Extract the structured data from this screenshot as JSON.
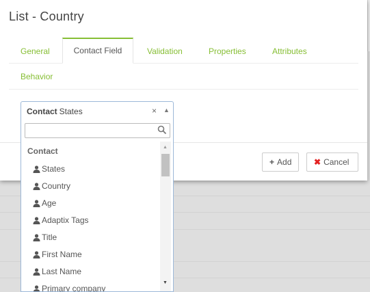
{
  "modal": {
    "title": "List - Country"
  },
  "tabs": [
    {
      "label": "General"
    },
    {
      "label": "Contact Field"
    },
    {
      "label": "Validation"
    },
    {
      "label": "Properties"
    },
    {
      "label": "Attributes"
    },
    {
      "label": "Behavior"
    }
  ],
  "active_tab": "Contact Field",
  "select": {
    "group": "Contact",
    "value": "States",
    "clear": "×",
    "arrow": "▲"
  },
  "dropdown": {
    "search_value": "",
    "group_label": "Contact",
    "options": [
      {
        "label": "States"
      },
      {
        "label": "Country"
      },
      {
        "label": "Age"
      },
      {
        "label": "Adaptix Tags"
      },
      {
        "label": "Title"
      },
      {
        "label": "First Name"
      },
      {
        "label": "Last Name"
      },
      {
        "label": "Primary company"
      }
    ],
    "option_icon": "user-icon"
  },
  "buttons": {
    "add_icon": "+",
    "add_label": "Add",
    "cancel_icon": "✖",
    "cancel_label": "Cancel"
  },
  "colors": {
    "accent_green": "#86be34",
    "cancel_red": "#e32121",
    "focus_border": "#9cb8d8"
  }
}
